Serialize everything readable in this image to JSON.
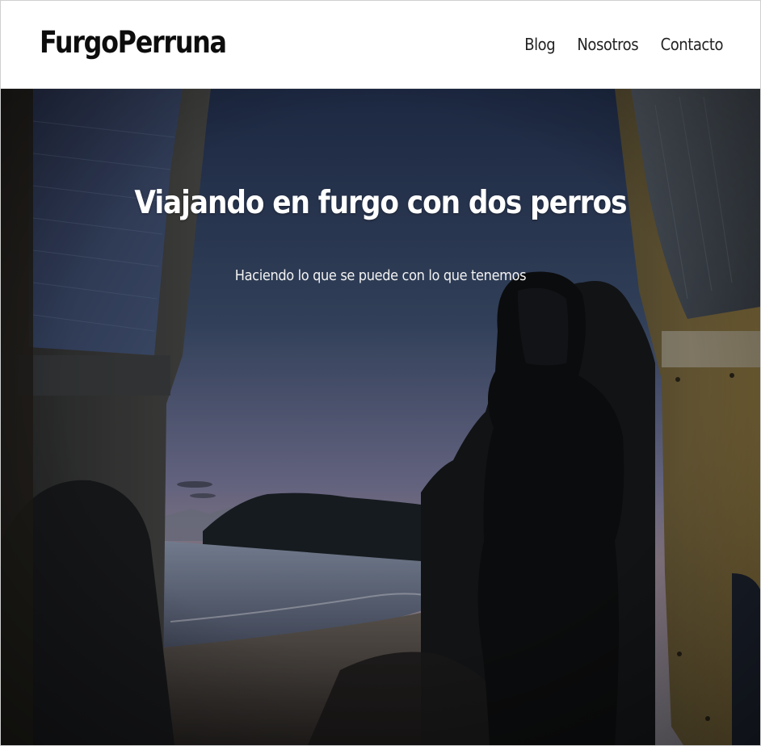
{
  "header": {
    "logo_text": "FurgoPerruna",
    "nav": [
      {
        "label": "Blog"
      },
      {
        "label": "Nosotros"
      },
      {
        "label": "Contacto"
      }
    ]
  },
  "hero": {
    "title": "Viajando en furgo con dos perros",
    "subtitle": "Haciendo lo que se puede con lo que tenemos",
    "background": "photo-van-doors-beach-sunset-person-in-hood"
  },
  "colors": {
    "header_bg": "#ffffff",
    "logo": "#0d0d0d",
    "nav_text": "#222222",
    "hero_text": "#ffffff",
    "sky_top": "#2c3c5c",
    "sky_bottom": "#9a8fa2"
  }
}
